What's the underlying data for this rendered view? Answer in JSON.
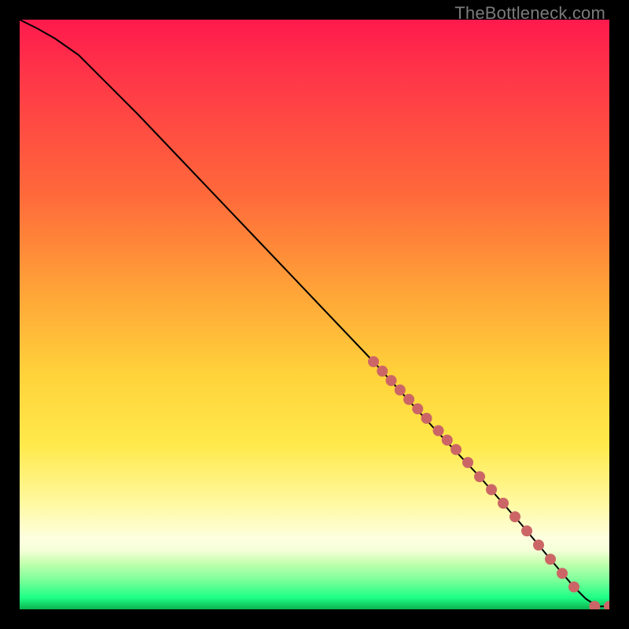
{
  "watermark": "TheBottleneck.com",
  "chart_data": {
    "type": "line",
    "title": "",
    "xlabel": "",
    "ylabel": "",
    "xlim": [
      0,
      100
    ],
    "ylim": [
      0,
      100
    ],
    "curve": {
      "name": "bottleneck-curve",
      "x": [
        0,
        3,
        6,
        10,
        20,
        30,
        40,
        50,
        60,
        70,
        78,
        85,
        90,
        94,
        96,
        98,
        100
      ],
      "y": [
        100,
        98.5,
        96.8,
        94,
        84,
        73.5,
        63,
        52.5,
        42,
        31,
        22.5,
        14.5,
        8.5,
        3.8,
        1.8,
        0.5,
        0.5
      ]
    },
    "points": {
      "name": "highlighted-segment",
      "x": [
        60,
        61.5,
        63,
        64.5,
        66,
        67.5,
        69,
        71,
        72.5,
        74,
        76,
        78,
        80,
        82,
        84,
        86,
        88,
        90,
        92,
        94,
        97.5,
        100
      ],
      "y": [
        42,
        40.4,
        38.8,
        37.2,
        35.6,
        34,
        32.4,
        30.3,
        28.7,
        27.1,
        24.9,
        22.5,
        20.3,
        18,
        15.7,
        13.3,
        10.9,
        8.5,
        6.1,
        3.8,
        0.5,
        0.5
      ]
    }
  }
}
